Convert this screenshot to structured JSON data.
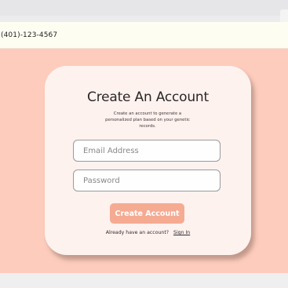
{
  "header": {
    "phone": "(401)-123-4567"
  },
  "card": {
    "title": "Create An Account",
    "subtitle": "Create an account to generate a personalized plan based on your genetic records."
  },
  "form": {
    "email_placeholder": "Email Address",
    "password_placeholder": "Password",
    "submit_label": "Create Account"
  },
  "footer": {
    "prompt": "Already have an account?",
    "link_label": "Sign In"
  },
  "colors": {
    "page_background": "#fdccbc",
    "card_background": "#fef2ef",
    "button_background": "#f5ab92",
    "header_strip": "#fefdf2"
  }
}
